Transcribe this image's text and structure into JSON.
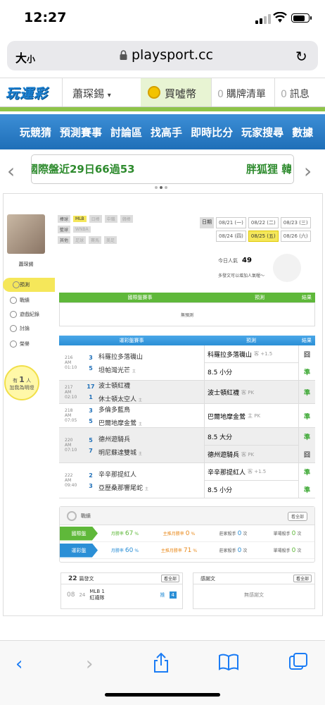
{
  "status": {
    "time": "12:27"
  },
  "browser": {
    "text_size": "大",
    "text_size_small": "小",
    "url": "playsport.cc"
  },
  "site": {
    "logo": "玩運彩",
    "user": "蕭琛錫",
    "buy_label": "買噓幣",
    "cart_count": "0",
    "cart_label": "購牌清單",
    "msg_count": "0",
    "msg_label": "訊息"
  },
  "nav": [
    "玩競猜",
    "預測賽事",
    "討論區",
    "找高手",
    "即時比分",
    "玩家搜尋",
    "數據"
  ],
  "marquee": {
    "left": "國際盤近29日66過53",
    "right": "胖狐狸 韓"
  },
  "profile": {
    "name": "蕭琛錫",
    "menu": [
      "預測",
      "戰績",
      "遊戲紀錄",
      "討論",
      "榮譽"
    ],
    "bulb": {
      "pre": "有",
      "count": "1",
      "unit": "人",
      "text": "加我為明燈"
    }
  },
  "filter": {
    "rows": [
      {
        "label": "棒球",
        "tags": [
          "MLB",
          "日棒",
          "中職",
          "韓棒"
        ]
      },
      {
        "label": "籃球",
        "tags": [
          "WNBA"
        ]
      },
      {
        "label": "其他",
        "tags": [
          "足球",
          "賽馬",
          "美足"
        ]
      }
    ],
    "date_label": "日期",
    "dates": [
      "08/21 (一)",
      "08/22 (二)",
      "08/23 (三)",
      "08/24 (四)",
      "08/25 (五)",
      "08/26 (六)"
    ],
    "active_date": "08/25 (五)",
    "popularity_label": "今日人氣",
    "popularity": "49",
    "note": "多發文可以增加人氣喔～"
  },
  "intl": {
    "col1": "國際盤賽事",
    "col2": "預測",
    "col3": "結果",
    "empty": "無預測"
  },
  "lottery": {
    "col1": "運彩盤賽事",
    "col2": "預測",
    "col3": "結果",
    "games": [
      {
        "no": "216",
        "time": "AM 01:10",
        "s1": "3",
        "s2": "5",
        "t1": "科羅拉多落磯山",
        "t2": "坦帕灣光芒",
        "home": "主",
        "p1": "科羅拉多落磯山",
        "p1s": "客 +1.5",
        "r1": "囧",
        "p2": "8.5 小分",
        "p2s": "",
        "r2": "準"
      },
      {
        "no": "217",
        "time": "AM 02:10",
        "s1": "17",
        "s2": "1",
        "t1": "波士頓紅襪",
        "t2": "休士頓太空人",
        "home": "主",
        "p1": "波士頓紅襪",
        "p1s": "客 PK",
        "r1": "準"
      },
      {
        "no": "218",
        "time": "AM 07:05",
        "s1": "3",
        "s2": "5",
        "t1": "多倫多藍鳥",
        "t2": "巴爾地摩金鶯",
        "home": "主",
        "p1": "巴爾地摩金鶯",
        "p1s": "主 PK",
        "r1": "準"
      },
      {
        "no": "220",
        "time": "AM 07:10",
        "s1": "5",
        "s2": "7",
        "t1": "德州遊騎兵",
        "t2": "明尼蘇達雙城",
        "home": "主",
        "p1": "8.5 大分",
        "p1s": "",
        "r1": "準",
        "p2": "德州遊騎兵",
        "p2s": "客 PK",
        "r2": "囧"
      },
      {
        "no": "222",
        "time": "AM 09:40",
        "s1": "2",
        "s2": "3",
        "t1": "辛辛那提紅人",
        "t2": "亞歷桑那響尾蛇",
        "home": "主",
        "p1": "辛辛那提紅人",
        "p1s": "客 +1.5",
        "r1": "準",
        "p2": "8.5 小分",
        "p2s": "",
        "r2": "準"
      }
    ]
  },
  "stats": {
    "title": "戰績",
    "more": "看全部",
    "rows": [
      {
        "label": "國際盤",
        "color": "#5fb83a",
        "win_label": "月勝率",
        "win": "67",
        "pct": "%",
        "main_label": "主推月勝率",
        "main": "0",
        "kill_label": "莊家殺手",
        "kill": "0",
        "kill_unit": "次",
        "single_label": "單場殺手",
        "single": "0",
        "single_unit": "次"
      },
      {
        "label": "運彩盤",
        "color": "#2b8fd6",
        "win_label": "月勝率",
        "win": "60",
        "pct": "%",
        "main_label": "主推月勝率",
        "main": "71",
        "kill_label": "莊家殺手",
        "kill": "0",
        "kill_unit": "次",
        "single_label": "單場殺手",
        "single": "0",
        "single_unit": "次"
      }
    ]
  },
  "posts": {
    "count": "22",
    "label": "篇發文",
    "more": "看全部",
    "day": "08",
    "day2": "24",
    "league": "MLB",
    "idx": "1",
    "team": "紅襪隊",
    "tag": "推",
    "num": "4"
  },
  "thanks": {
    "label": "感謝文",
    "more": "看全部",
    "empty": "無感謝文"
  }
}
